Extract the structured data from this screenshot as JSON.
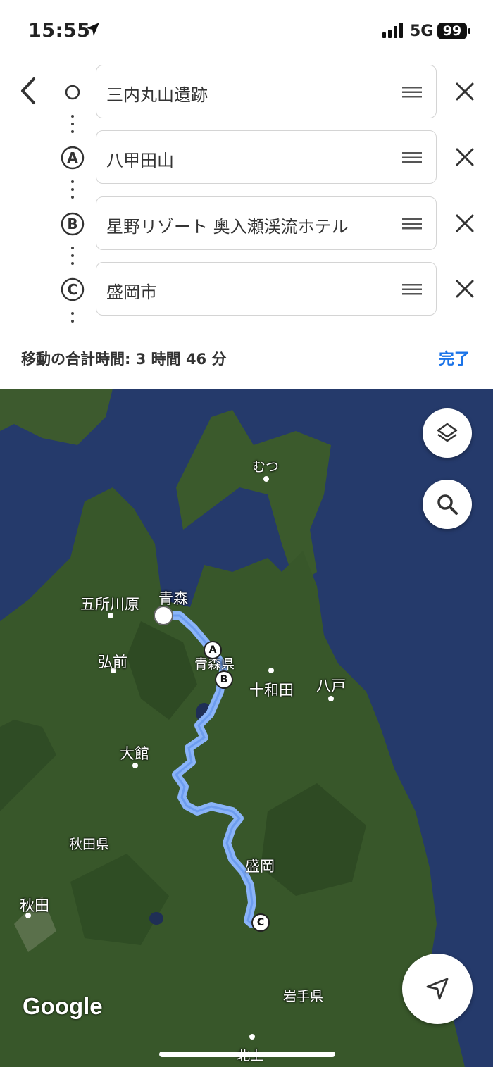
{
  "status_bar": {
    "time": "15:55",
    "network": "5G",
    "battery": "99"
  },
  "route": {
    "stops": [
      {
        "marker": "",
        "name": "三内丸山遺跡"
      },
      {
        "marker": "A",
        "name": "八甲田山"
      },
      {
        "marker": "B",
        "name": "星野リゾート 奥入瀬渓流ホテル"
      },
      {
        "marker": "C",
        "name": "盛岡市"
      }
    ],
    "summary": "移動の合計時間: 3 時間 46 分",
    "done_label": "完了"
  },
  "map": {
    "labels": {
      "mutsu": "むつ",
      "goshogawara": "五所川原",
      "aomori": "青森",
      "hirosaki": "弘前",
      "aomori_pref": "青森県",
      "towada": "十和田",
      "hachinohe": "八戸",
      "odate": "大館",
      "akita_pref": "秋田県",
      "morioka": "盛岡",
      "akita": "秋田",
      "iwate_pref": "岩手県",
      "kitakami": "北上"
    },
    "pins": [
      "A",
      "B",
      "C"
    ],
    "attribution": "Google",
    "colors": {
      "route": "#8ab4f8",
      "land": "#3a5a2c",
      "sea": "#253a6b",
      "accent": "#1a73e8"
    }
  }
}
